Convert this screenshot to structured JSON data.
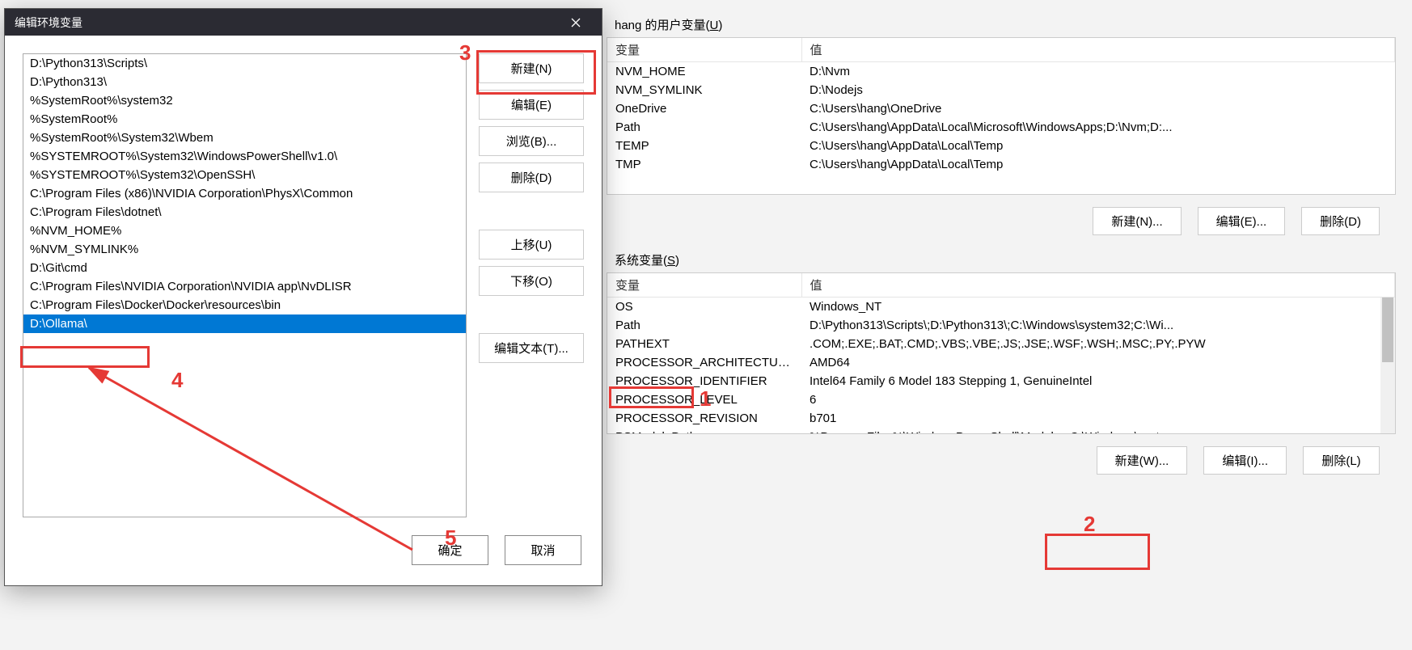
{
  "bg": {
    "user_section_label_prefix": "hang 的用户变量(",
    "user_section_key": "U",
    "user_section_suffix": ")",
    "sys_section_label_prefix": "系统变量(",
    "sys_section_key": "S",
    "sys_section_suffix": ")",
    "col_var": "变量",
    "col_val": "值",
    "user_vars": [
      {
        "name": "NVM_HOME",
        "value": "D:\\Nvm"
      },
      {
        "name": "NVM_SYMLINK",
        "value": "D:\\Nodejs"
      },
      {
        "name": "OneDrive",
        "value": "C:\\Users\\hang\\OneDrive"
      },
      {
        "name": "Path",
        "value": "C:\\Users\\hang\\AppData\\Local\\Microsoft\\WindowsApps;D:\\Nvm;D:..."
      },
      {
        "name": "TEMP",
        "value": "C:\\Users\\hang\\AppData\\Local\\Temp"
      },
      {
        "name": "TMP",
        "value": "C:\\Users\\hang\\AppData\\Local\\Temp"
      }
    ],
    "sys_vars": [
      {
        "name": "OS",
        "value": "Windows_NT"
      },
      {
        "name": "Path",
        "value": "D:\\Python313\\Scripts\\;D:\\Python313\\;C:\\Windows\\system32;C:\\Wi..."
      },
      {
        "name": "PATHEXT",
        "value": ".COM;.EXE;.BAT;.CMD;.VBS;.VBE;.JS;.JSE;.WSF;.WSH;.MSC;.PY;.PYW"
      },
      {
        "name": "PROCESSOR_ARCHITECTURE",
        "value": "AMD64"
      },
      {
        "name": "PROCESSOR_IDENTIFIER",
        "value": "Intel64 Family 6 Model 183 Stepping 1, GenuineIntel"
      },
      {
        "name": "PROCESSOR_LEVEL",
        "value": "6"
      },
      {
        "name": "PROCESSOR_REVISION",
        "value": "b701"
      },
      {
        "name": "PSModulePath",
        "value": "%ProgramFiles%\\WindowsPowerShell\\Modules;C:\\Windows\\syste"
      }
    ],
    "btn_new": "新建(W)...",
    "btn_edit": "编辑(E)...",
    "btn_delete": "删除(D)",
    "btn_new2": "新建(N)...",
    "btn_edit2": "编辑(I)...",
    "btn_delete2": "删除(L)"
  },
  "modal": {
    "title": "编辑环境变量",
    "paths": [
      "D:\\Python313\\Scripts\\",
      "D:\\Python313\\",
      "%SystemRoot%\\system32",
      "%SystemRoot%",
      "%SystemRoot%\\System32\\Wbem",
      "%SYSTEMROOT%\\System32\\WindowsPowerShell\\v1.0\\",
      "%SYSTEMROOT%\\System32\\OpenSSH\\",
      "C:\\Program Files (x86)\\NVIDIA Corporation\\PhysX\\Common",
      "C:\\Program Files\\dotnet\\",
      "%NVM_HOME%",
      "%NVM_SYMLINK%",
      "D:\\Git\\cmd",
      "C:\\Program Files\\NVIDIA Corporation\\NVIDIA app\\NvDLISR",
      "C:\\Program Files\\Docker\\Docker\\resources\\bin",
      "D:\\Ollama\\"
    ],
    "selected_index": 14,
    "btn_new": "新建(N)",
    "btn_edit": "编辑(E)",
    "btn_browse": "浏览(B)...",
    "btn_delete": "删除(D)",
    "btn_up": "上移(U)",
    "btn_down": "下移(O)",
    "btn_edit_text": "编辑文本(T)...",
    "btn_ok": "确定",
    "btn_cancel": "取消"
  },
  "annotations": {
    "n1": "1",
    "n2": "2",
    "n3": "3",
    "n4": "4",
    "n5": "5"
  }
}
